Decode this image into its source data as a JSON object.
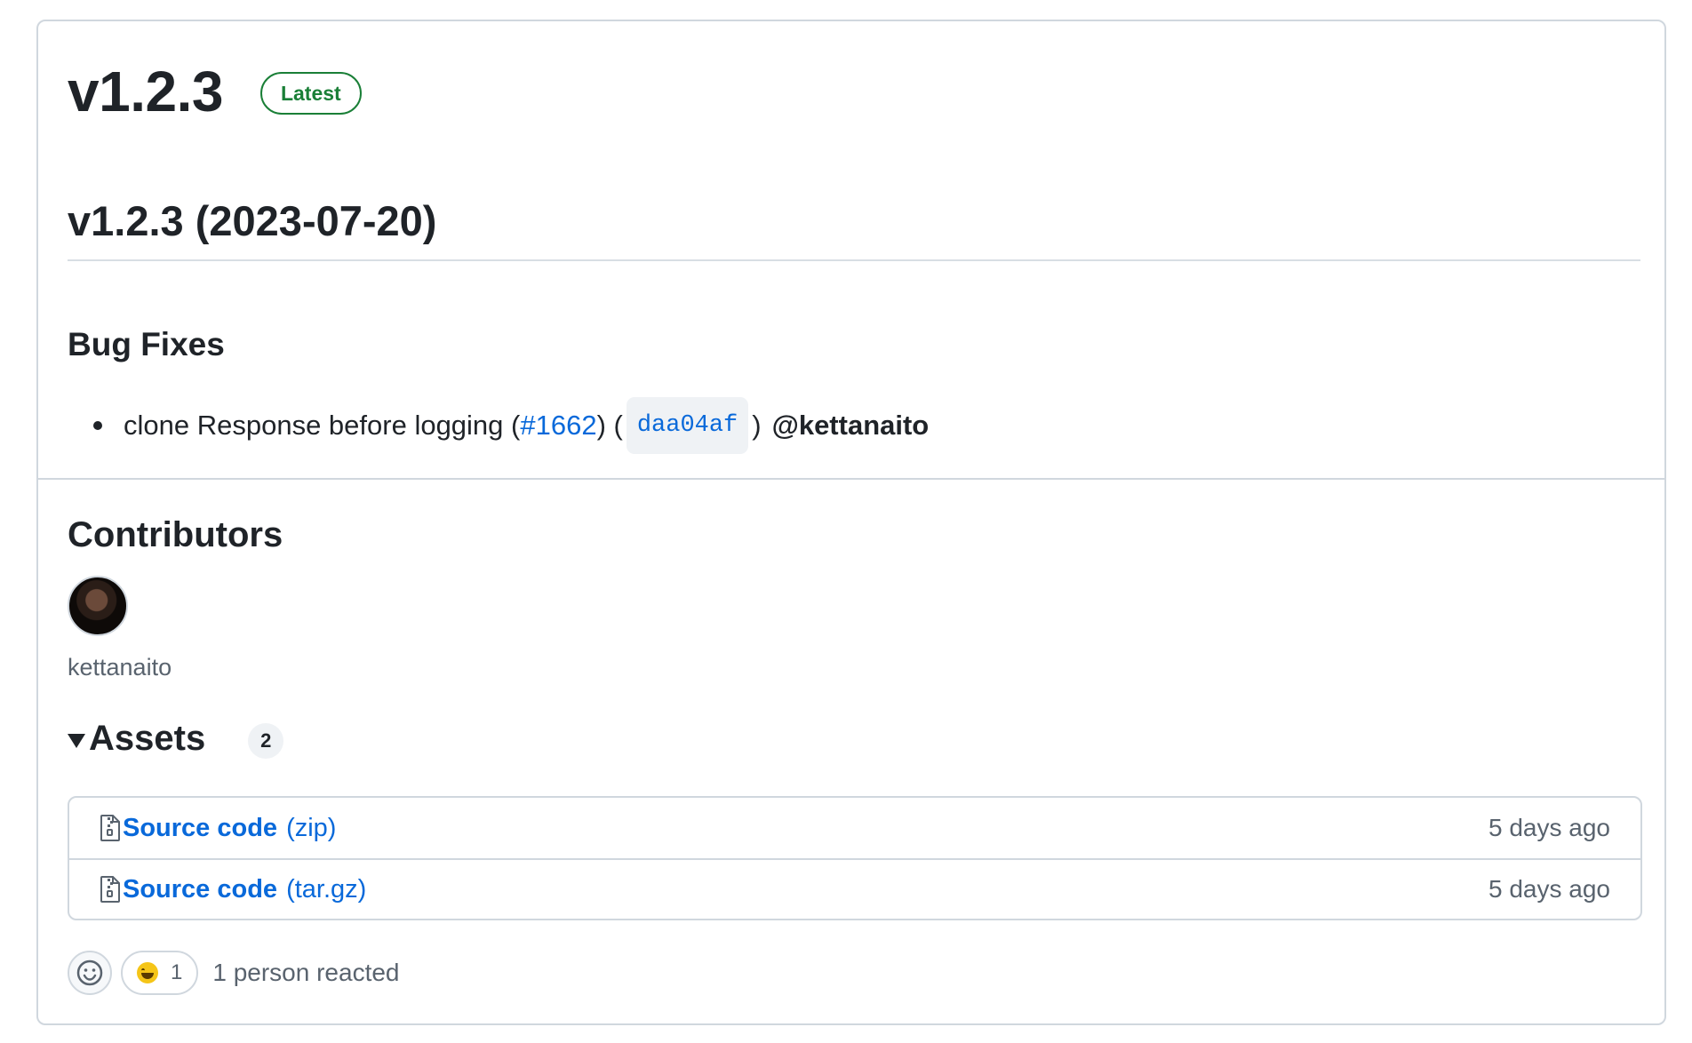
{
  "release": {
    "title": "v1.2.3",
    "badge": "Latest",
    "heading": "v1.2.3 (2023-07-20)",
    "section": "Bug Fixes",
    "item": {
      "text_before": "clone Response before logging (",
      "pr_link": "#1662",
      "text_mid": ") (",
      "commit": "daa04af",
      "text_after": ")",
      "mention": "@kettanaito"
    }
  },
  "contributors": {
    "title": "Contributors",
    "name": "kettanaito"
  },
  "assets": {
    "title": "Assets",
    "count": "2",
    "items": [
      {
        "name": "Source code",
        "ext": "(zip)",
        "date": "5 days ago"
      },
      {
        "name": "Source code",
        "ext": "(tar.gz)",
        "date": "5 days ago"
      }
    ]
  },
  "reactions": {
    "count": "1",
    "summary": "1 person reacted"
  }
}
